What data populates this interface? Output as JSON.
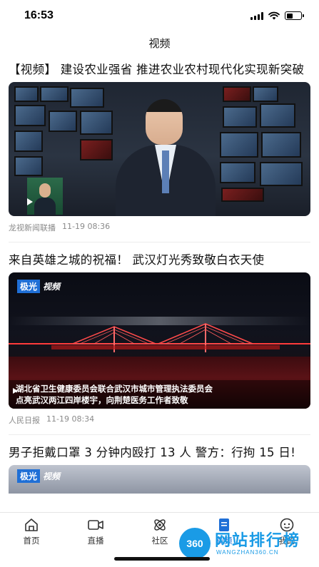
{
  "status_bar": {
    "time": "16:53"
  },
  "header": {
    "title": "视频"
  },
  "articles": [
    {
      "title": "【视频】 建设农业强省 推进农业农村现代化实现新突破",
      "source": "龙视新闻联播",
      "timestamp": "11-19 08:36"
    },
    {
      "title": "来自英雄之城的祝福！ 武汉灯光秀致敬白衣天使",
      "source": "人民日报",
      "timestamp": "11-19 08:34",
      "badge_primary": "极光",
      "badge_secondary": "视频",
      "caption_line1": "湖北省卫生健康委员会联合武汉市城市管理执法委员会",
      "caption_line2": "点亮武汉两江四岸楼宇，向荆楚医务工作者致敬"
    },
    {
      "title": "男子拒戴口罩 3 分钟内殴打 13 人 警方：行拘 15 日!",
      "badge_primary": "极光",
      "badge_secondary": "视频"
    }
  ],
  "tab_bar": {
    "items": [
      {
        "label": "首页",
        "icon": "home-icon"
      },
      {
        "label": "直播",
        "icon": "video-camera-icon"
      },
      {
        "label": "社区",
        "icon": "community-icon"
      },
      {
        "label": "视频",
        "icon": "video-doc-icon",
        "active": true
      },
      {
        "label": "我的",
        "icon": "profile-icon"
      }
    ]
  },
  "watermark": {
    "logo": "360",
    "text": "网站排行榜",
    "sub": "WANGZHAN360.CN"
  },
  "colors": {
    "accent": "#1f6fd6",
    "meta_text": "#8a8a8a",
    "watermark": "#1a9be6"
  }
}
